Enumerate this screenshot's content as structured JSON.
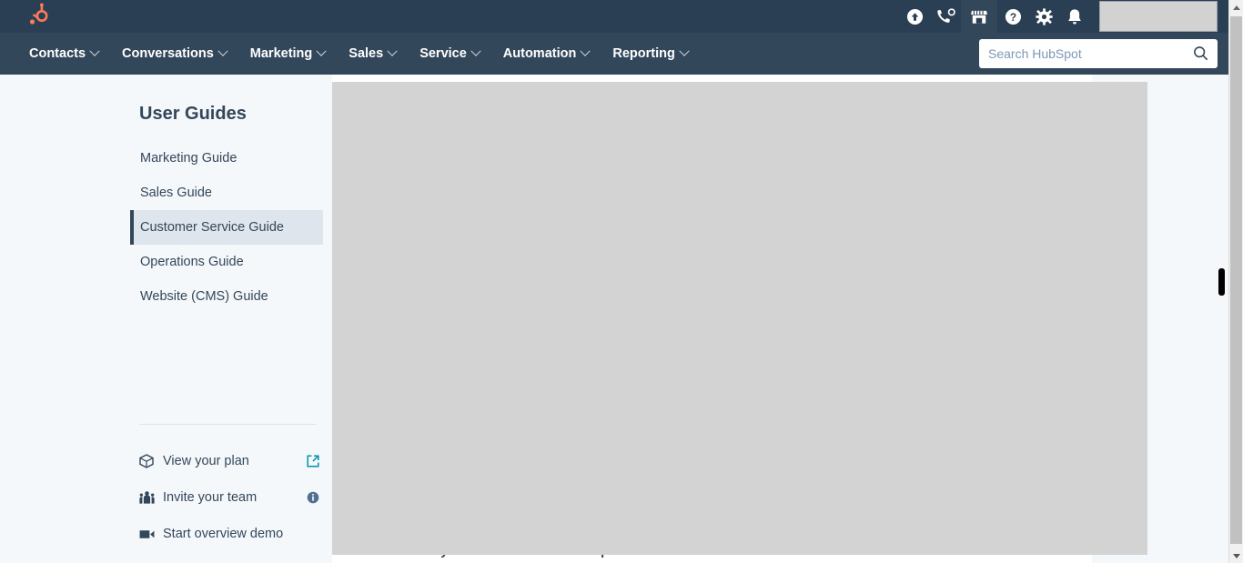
{
  "topbar": {
    "logo": "hubspot-sprocket-logo",
    "icons": [
      {
        "name": "upgrade-icon",
        "label": "Upgrade"
      },
      {
        "name": "calling-icon",
        "label": "Calling"
      },
      {
        "name": "marketplace-icon",
        "label": "Marketplace"
      },
      {
        "name": "help-icon",
        "label": "Help"
      },
      {
        "name": "settings-icon",
        "label": "Settings"
      },
      {
        "name": "notifications-icon",
        "label": "Notifications"
      }
    ],
    "account_box": ""
  },
  "nav": {
    "items": [
      {
        "label": "Contacts"
      },
      {
        "label": "Conversations"
      },
      {
        "label": "Marketing"
      },
      {
        "label": "Sales"
      },
      {
        "label": "Service"
      },
      {
        "label": "Automation"
      },
      {
        "label": "Reporting"
      }
    ]
  },
  "search": {
    "placeholder": "Search HubSpot",
    "value": ""
  },
  "sidebar": {
    "title": "User Guides",
    "guides": [
      {
        "label": "Marketing Guide",
        "active": false
      },
      {
        "label": "Sales Guide",
        "active": false
      },
      {
        "label": "Customer Service Guide",
        "active": true
      },
      {
        "label": "Operations Guide",
        "active": false
      },
      {
        "label": "Website (CMS) Guide",
        "active": false
      }
    ],
    "links": [
      {
        "label": "View your plan",
        "lead_icon": "box-icon",
        "trail_icon": "external-link-icon"
      },
      {
        "label": "Invite your team",
        "lead_icon": "people-icon",
        "trail_icon": "info-icon"
      },
      {
        "label": "Start overview demo",
        "lead_icon": "video-icon",
        "trail_icon": ""
      }
    ]
  },
  "main": {
    "task": {
      "chevron": "›",
      "label": "Connect your team email to HubSpot"
    }
  },
  "colors": {
    "topbar_bg": "#2a3f54",
    "navbar_bg": "#33475b",
    "page_bg": "#f5f8fa",
    "brand_orange": "#ff7a59",
    "accent_teal": "#00a4bd",
    "active_item_bg": "#dfe5ec",
    "overlay_gray": "#d3d3d3"
  }
}
